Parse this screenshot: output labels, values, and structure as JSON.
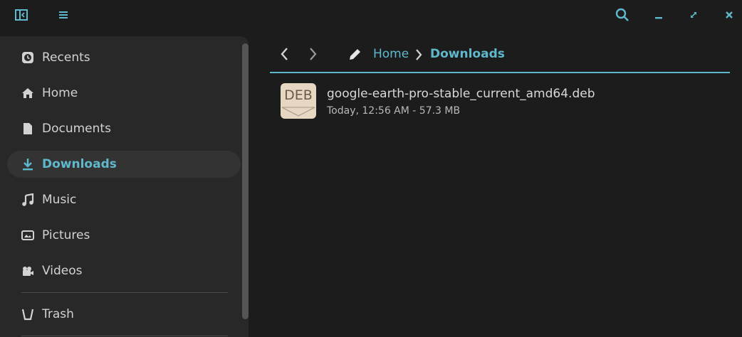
{
  "titlebar": {
    "sidebar_toggle_icon": "sidebar-toggle-icon",
    "menu_icon": "hamburger-menu-icon",
    "search_icon": "search-icon",
    "minimize_icon": "minimize-icon",
    "maximize_icon": "maximize-icon",
    "close_icon": "close-icon"
  },
  "sidebar": {
    "items": [
      {
        "label": "Recents",
        "icon": "clock-icon"
      },
      {
        "label": "Home",
        "icon": "home-icon"
      },
      {
        "label": "Documents",
        "icon": "document-icon"
      },
      {
        "label": "Downloads",
        "icon": "download-icon",
        "active": true
      },
      {
        "label": "Music",
        "icon": "music-icon"
      },
      {
        "label": "Pictures",
        "icon": "picture-icon"
      },
      {
        "label": "Videos",
        "icon": "video-icon"
      },
      {
        "label": "Trash",
        "icon": "trash-icon"
      }
    ]
  },
  "toolbar": {
    "back_icon": "chevron-left-icon",
    "forward_icon": "chevron-right-icon",
    "edit_icon": "pencil-icon"
  },
  "breadcrumb": {
    "parent": "Home",
    "separator_icon": "chevron-right-icon",
    "current": "Downloads"
  },
  "files": [
    {
      "thumb_text": "DEB",
      "name": "google-earth-pro-stable_current_amd64.deb",
      "meta": "Today, 12:56 AM - 57.3 MB"
    }
  ],
  "colors": {
    "accent": "#5fb8cc",
    "background": "#1c1c1c",
    "sidebar": "#282828",
    "active_item": "#333333"
  }
}
